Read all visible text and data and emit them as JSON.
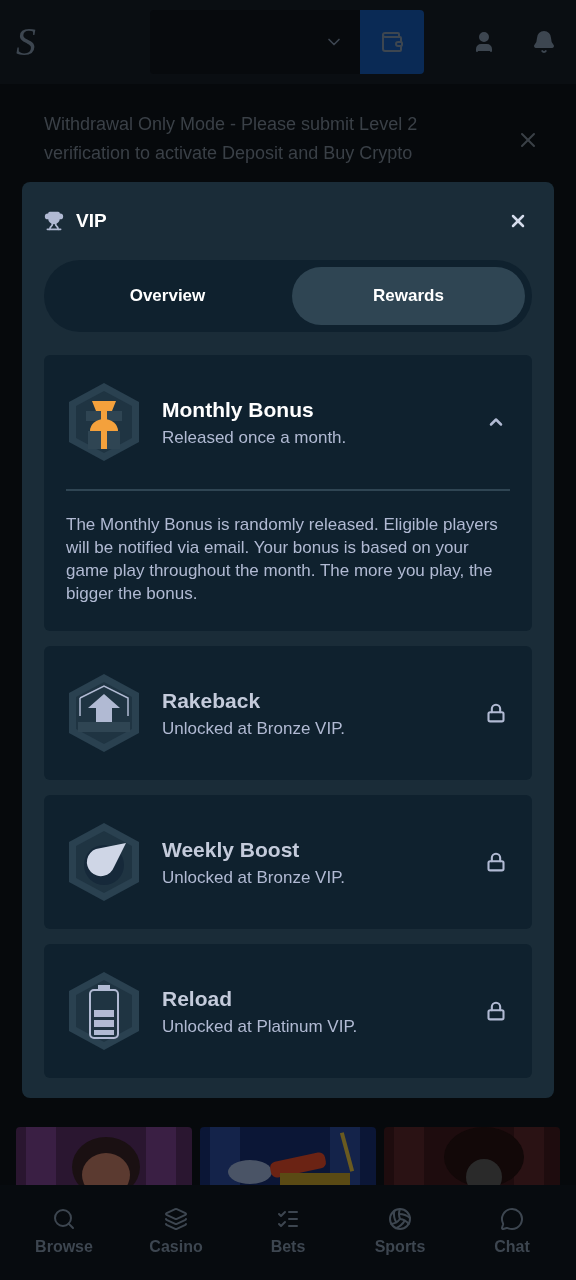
{
  "header": {
    "logo": "S"
  },
  "banner": {
    "text": "Withdrawal Only Mode - Please submit Level 2 verification to activate Deposit and Buy Crypto"
  },
  "modal": {
    "title": "VIP",
    "tabs": [
      {
        "label": "Overview",
        "selected": false
      },
      {
        "label": "Rewards",
        "selected": true
      }
    ],
    "rewards": [
      {
        "kind": "gift",
        "title": "Monthly Bonus",
        "subtitle": "Released once a month.",
        "locked": false,
        "expanded": true,
        "description": "The Monthly Bonus is randomly released. Eligible players will be notified via email. Your bonus is based on your game play throughout the month. The more you play, the bigger the bonus."
      },
      {
        "kind": "arrow",
        "title": "Rakeback",
        "subtitle": "Unlocked at Bronze VIP.",
        "locked": true
      },
      {
        "kind": "comet",
        "title": "Weekly Boost",
        "subtitle": "Unlocked at Bronze VIP.",
        "locked": true
      },
      {
        "kind": "battery",
        "title": "Reload",
        "subtitle": "Unlocked at Platinum VIP.",
        "locked": true
      }
    ]
  },
  "nav": [
    {
      "kind": "browse",
      "label": "Browse"
    },
    {
      "kind": "casino",
      "label": "Casino"
    },
    {
      "kind": "bets",
      "label": "Bets"
    },
    {
      "kind": "sports",
      "label": "Sports"
    },
    {
      "kind": "chat",
      "label": "Chat"
    }
  ]
}
